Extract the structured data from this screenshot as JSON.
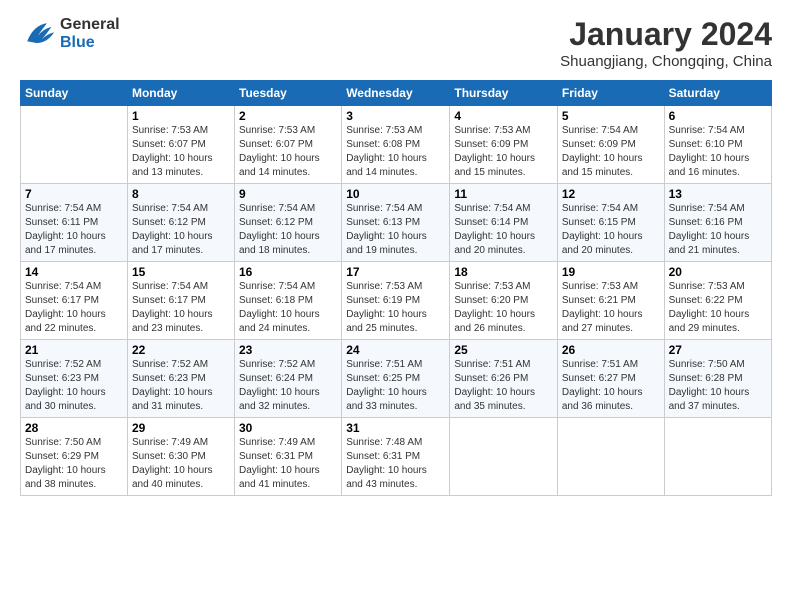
{
  "header": {
    "logo_line1": "General",
    "logo_line2": "Blue",
    "month_title": "January 2024",
    "location": "Shuangjiang, Chongqing, China"
  },
  "columns": [
    "Sunday",
    "Monday",
    "Tuesday",
    "Wednesday",
    "Thursday",
    "Friday",
    "Saturday"
  ],
  "weeks": [
    [
      {
        "day": "",
        "sunrise": "",
        "sunset": "",
        "daylight": ""
      },
      {
        "day": "1",
        "sunrise": "Sunrise: 7:53 AM",
        "sunset": "Sunset: 6:07 PM",
        "daylight": "Daylight: 10 hours and 13 minutes."
      },
      {
        "day": "2",
        "sunrise": "Sunrise: 7:53 AM",
        "sunset": "Sunset: 6:07 PM",
        "daylight": "Daylight: 10 hours and 14 minutes."
      },
      {
        "day": "3",
        "sunrise": "Sunrise: 7:53 AM",
        "sunset": "Sunset: 6:08 PM",
        "daylight": "Daylight: 10 hours and 14 minutes."
      },
      {
        "day": "4",
        "sunrise": "Sunrise: 7:53 AM",
        "sunset": "Sunset: 6:09 PM",
        "daylight": "Daylight: 10 hours and 15 minutes."
      },
      {
        "day": "5",
        "sunrise": "Sunrise: 7:54 AM",
        "sunset": "Sunset: 6:09 PM",
        "daylight": "Daylight: 10 hours and 15 minutes."
      },
      {
        "day": "6",
        "sunrise": "Sunrise: 7:54 AM",
        "sunset": "Sunset: 6:10 PM",
        "daylight": "Daylight: 10 hours and 16 minutes."
      }
    ],
    [
      {
        "day": "7",
        "sunrise": "Sunrise: 7:54 AM",
        "sunset": "Sunset: 6:11 PM",
        "daylight": "Daylight: 10 hours and 17 minutes."
      },
      {
        "day": "8",
        "sunrise": "Sunrise: 7:54 AM",
        "sunset": "Sunset: 6:12 PM",
        "daylight": "Daylight: 10 hours and 17 minutes."
      },
      {
        "day": "9",
        "sunrise": "Sunrise: 7:54 AM",
        "sunset": "Sunset: 6:12 PM",
        "daylight": "Daylight: 10 hours and 18 minutes."
      },
      {
        "day": "10",
        "sunrise": "Sunrise: 7:54 AM",
        "sunset": "Sunset: 6:13 PM",
        "daylight": "Daylight: 10 hours and 19 minutes."
      },
      {
        "day": "11",
        "sunrise": "Sunrise: 7:54 AM",
        "sunset": "Sunset: 6:14 PM",
        "daylight": "Daylight: 10 hours and 20 minutes."
      },
      {
        "day": "12",
        "sunrise": "Sunrise: 7:54 AM",
        "sunset": "Sunset: 6:15 PM",
        "daylight": "Daylight: 10 hours and 20 minutes."
      },
      {
        "day": "13",
        "sunrise": "Sunrise: 7:54 AM",
        "sunset": "Sunset: 6:16 PM",
        "daylight": "Daylight: 10 hours and 21 minutes."
      }
    ],
    [
      {
        "day": "14",
        "sunrise": "Sunrise: 7:54 AM",
        "sunset": "Sunset: 6:17 PM",
        "daylight": "Daylight: 10 hours and 22 minutes."
      },
      {
        "day": "15",
        "sunrise": "Sunrise: 7:54 AM",
        "sunset": "Sunset: 6:17 PM",
        "daylight": "Daylight: 10 hours and 23 minutes."
      },
      {
        "day": "16",
        "sunrise": "Sunrise: 7:54 AM",
        "sunset": "Sunset: 6:18 PM",
        "daylight": "Daylight: 10 hours and 24 minutes."
      },
      {
        "day": "17",
        "sunrise": "Sunrise: 7:53 AM",
        "sunset": "Sunset: 6:19 PM",
        "daylight": "Daylight: 10 hours and 25 minutes."
      },
      {
        "day": "18",
        "sunrise": "Sunrise: 7:53 AM",
        "sunset": "Sunset: 6:20 PM",
        "daylight": "Daylight: 10 hours and 26 minutes."
      },
      {
        "day": "19",
        "sunrise": "Sunrise: 7:53 AM",
        "sunset": "Sunset: 6:21 PM",
        "daylight": "Daylight: 10 hours and 27 minutes."
      },
      {
        "day": "20",
        "sunrise": "Sunrise: 7:53 AM",
        "sunset": "Sunset: 6:22 PM",
        "daylight": "Daylight: 10 hours and 29 minutes."
      }
    ],
    [
      {
        "day": "21",
        "sunrise": "Sunrise: 7:52 AM",
        "sunset": "Sunset: 6:23 PM",
        "daylight": "Daylight: 10 hours and 30 minutes."
      },
      {
        "day": "22",
        "sunrise": "Sunrise: 7:52 AM",
        "sunset": "Sunset: 6:23 PM",
        "daylight": "Daylight: 10 hours and 31 minutes."
      },
      {
        "day": "23",
        "sunrise": "Sunrise: 7:52 AM",
        "sunset": "Sunset: 6:24 PM",
        "daylight": "Daylight: 10 hours and 32 minutes."
      },
      {
        "day": "24",
        "sunrise": "Sunrise: 7:51 AM",
        "sunset": "Sunset: 6:25 PM",
        "daylight": "Daylight: 10 hours and 33 minutes."
      },
      {
        "day": "25",
        "sunrise": "Sunrise: 7:51 AM",
        "sunset": "Sunset: 6:26 PM",
        "daylight": "Daylight: 10 hours and 35 minutes."
      },
      {
        "day": "26",
        "sunrise": "Sunrise: 7:51 AM",
        "sunset": "Sunset: 6:27 PM",
        "daylight": "Daylight: 10 hours and 36 minutes."
      },
      {
        "day": "27",
        "sunrise": "Sunrise: 7:50 AM",
        "sunset": "Sunset: 6:28 PM",
        "daylight": "Daylight: 10 hours and 37 minutes."
      }
    ],
    [
      {
        "day": "28",
        "sunrise": "Sunrise: 7:50 AM",
        "sunset": "Sunset: 6:29 PM",
        "daylight": "Daylight: 10 hours and 38 minutes."
      },
      {
        "day": "29",
        "sunrise": "Sunrise: 7:49 AM",
        "sunset": "Sunset: 6:30 PM",
        "daylight": "Daylight: 10 hours and 40 minutes."
      },
      {
        "day": "30",
        "sunrise": "Sunrise: 7:49 AM",
        "sunset": "Sunset: 6:31 PM",
        "daylight": "Daylight: 10 hours and 41 minutes."
      },
      {
        "day": "31",
        "sunrise": "Sunrise: 7:48 AM",
        "sunset": "Sunset: 6:31 PM",
        "daylight": "Daylight: 10 hours and 43 minutes."
      },
      {
        "day": "",
        "sunrise": "",
        "sunset": "",
        "daylight": ""
      },
      {
        "day": "",
        "sunrise": "",
        "sunset": "",
        "daylight": ""
      },
      {
        "day": "",
        "sunrise": "",
        "sunset": "",
        "daylight": ""
      }
    ]
  ]
}
